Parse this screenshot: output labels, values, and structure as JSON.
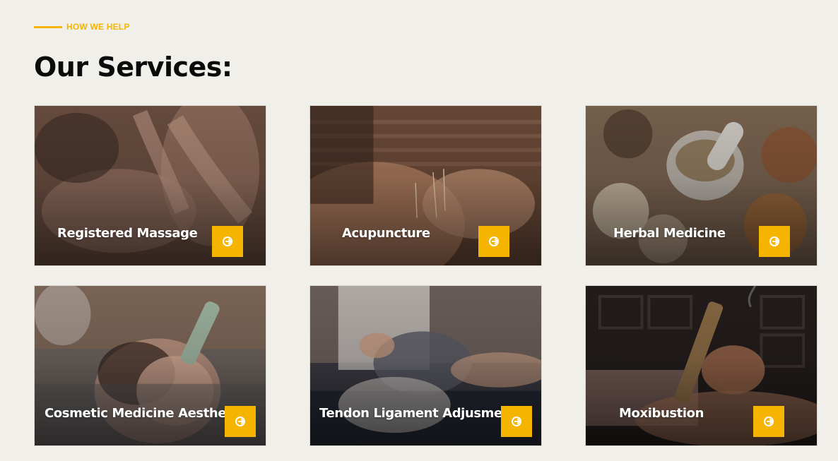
{
  "section": {
    "eyebrow": "HOW WE HELP",
    "title": "Our Services:"
  },
  "colors": {
    "accent": "#f5b400",
    "background": "#f0efea",
    "title": "#0b0b0b"
  },
  "services": [
    {
      "label": "Registered Massage",
      "image": "massage-photo",
      "button_icon": "arrow-circle-right-icon"
    },
    {
      "label": "Acupuncture",
      "image": "acupuncture-photo",
      "button_icon": "arrow-circle-right-icon"
    },
    {
      "label": "Herbal Medicine",
      "image": "herbal-medicine-photo",
      "button_icon": "arrow-circle-right-icon"
    },
    {
      "label": "Cosmetic Medicine Aesthetic",
      "image": "cosmetic-acupuncture-photo",
      "button_icon": "arrow-circle-right-icon"
    },
    {
      "label": "Tendon Ligament Adjusment",
      "image": "tendon-adjustment-photo",
      "button_icon": "arrow-circle-right-icon"
    },
    {
      "label": "Moxibustion",
      "image": "moxibustion-photo",
      "button_icon": "arrow-circle-right-icon"
    }
  ]
}
